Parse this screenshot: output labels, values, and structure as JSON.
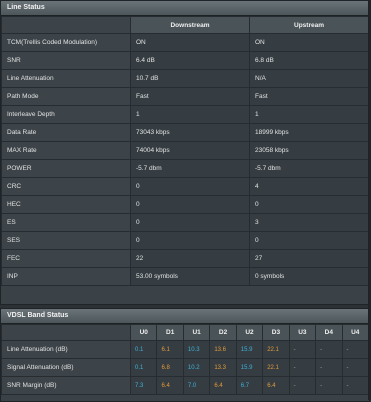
{
  "line_status": {
    "title": "Line Status",
    "columns": [
      "Downstream",
      "Upstream"
    ],
    "rows": [
      {
        "label": "TCM(Trellis Coded Modulation)",
        "down": "ON",
        "up": "ON"
      },
      {
        "label": "SNR",
        "down": "6.4 dB",
        "up": "6.8 dB"
      },
      {
        "label": "Line Attenuation",
        "down": "10.7 dB",
        "up": "N/A"
      },
      {
        "label": "Path Mode",
        "down": "Fast",
        "up": "Fast"
      },
      {
        "label": "Interleave Depth",
        "down": "1",
        "up": "1"
      },
      {
        "label": "Data Rate",
        "down": "73043 kbps",
        "up": "18999 kbps"
      },
      {
        "label": "MAX Rate",
        "down": "74004 kbps",
        "up": "23058 kbps"
      },
      {
        "label": "POWER",
        "down": "-5.7 dbm",
        "up": "-5.7 dbm"
      },
      {
        "label": "CRC",
        "down": "0",
        "up": "4"
      },
      {
        "label": "HEC",
        "down": "0",
        "up": "0"
      },
      {
        "label": "ES",
        "down": "0",
        "up": "3"
      },
      {
        "label": "SES",
        "down": "0",
        "up": "0"
      },
      {
        "label": "FEC",
        "down": "22",
        "up": "27"
      },
      {
        "label": "INP",
        "down": "53.00 symbols",
        "up": "0 symbols"
      }
    ]
  },
  "vdsl_band_status": {
    "title": "VDSL Band Status",
    "columns": [
      "U0",
      "D1",
      "U1",
      "D2",
      "U2",
      "D3",
      "U3",
      "D4",
      "U4"
    ],
    "column_colors": [
      "cyan",
      "orange",
      "cyan",
      "orange",
      "cyan",
      "orange",
      "gray",
      "gray",
      "gray"
    ],
    "rows": [
      {
        "label": "Line Attenuation (dB)",
        "values": [
          "0.1",
          "6.1",
          "10.3",
          "13.6",
          "15.9",
          "22.1",
          "-",
          "-",
          "-"
        ]
      },
      {
        "label": "Signal Attenuation (dB)",
        "values": [
          "0.1",
          "6.8",
          "10.2",
          "13.3",
          "15.9",
          "22.1",
          "-",
          "-",
          "-"
        ]
      },
      {
        "label": "SNR Margin (dB)",
        "values": [
          "7.3",
          "6.4",
          "7.0",
          "6.4",
          "6.7",
          "6.4",
          "-",
          "-",
          "-"
        ]
      }
    ]
  },
  "colors": {
    "cyan": "#3fb0d8",
    "orange": "#e49a3a",
    "panel": "#3a4247",
    "background": "#2b3134"
  }
}
